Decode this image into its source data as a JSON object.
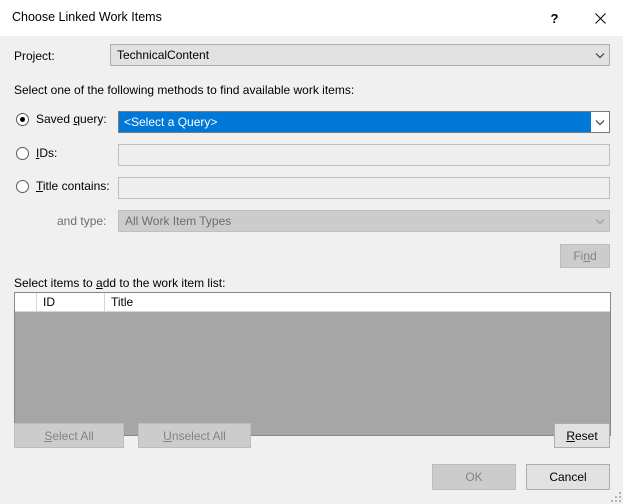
{
  "window": {
    "title": "Choose Linked Work Items",
    "help_icon": "question-mark-icon",
    "close_icon": "close-icon"
  },
  "project": {
    "label": "Project:",
    "value": "TechnicalContent",
    "arrow_icon": "chevron-down-icon"
  },
  "instruction": "Select one of the following methods to find available work items:",
  "methods": {
    "saved_query": {
      "label_pre": "Saved ",
      "label_accel": "q",
      "label_post": "uery:",
      "selected": true,
      "value": "<Select a Query>",
      "arrow_icon": "chevron-down-icon"
    },
    "ids": {
      "label_pre": "",
      "label_accel": "I",
      "label_post": "Ds:",
      "selected": false,
      "value": "",
      "placeholder": ""
    },
    "title_contains": {
      "label_pre": "",
      "label_accel": "T",
      "label_post": "itle contains:",
      "selected": false,
      "value": "",
      "placeholder": ""
    },
    "and_type": {
      "label": "and type:",
      "value": "All Work Item Types",
      "disabled": true,
      "arrow_icon": "chevron-down-icon"
    }
  },
  "find_button": {
    "label_pre": "Fi",
    "label_accel": "n",
    "label_post": "d",
    "disabled": true
  },
  "list": {
    "caption_pre": "Select items to ",
    "caption_accel": "a",
    "caption_post": "dd to the work item list:",
    "columns": [
      "",
      "ID",
      "Title"
    ],
    "rows": []
  },
  "bottom_buttons": {
    "select_all": {
      "label_pre": "",
      "label_accel": "S",
      "label_post": "elect All",
      "disabled": true
    },
    "unselect_all": {
      "label_pre": "",
      "label_accel": "U",
      "label_post": "nselect All",
      "disabled": true
    },
    "reset": {
      "label_pre": "",
      "label_accel": "R",
      "label_post": "eset",
      "disabled": false
    },
    "ok": {
      "label": "OK",
      "disabled": true
    },
    "cancel": {
      "label": "Cancel",
      "disabled": false
    }
  },
  "colors": {
    "selection_blue": "#0078d7",
    "dialog_background": "#f0f0f0",
    "list_background": "#a6a6a6"
  }
}
